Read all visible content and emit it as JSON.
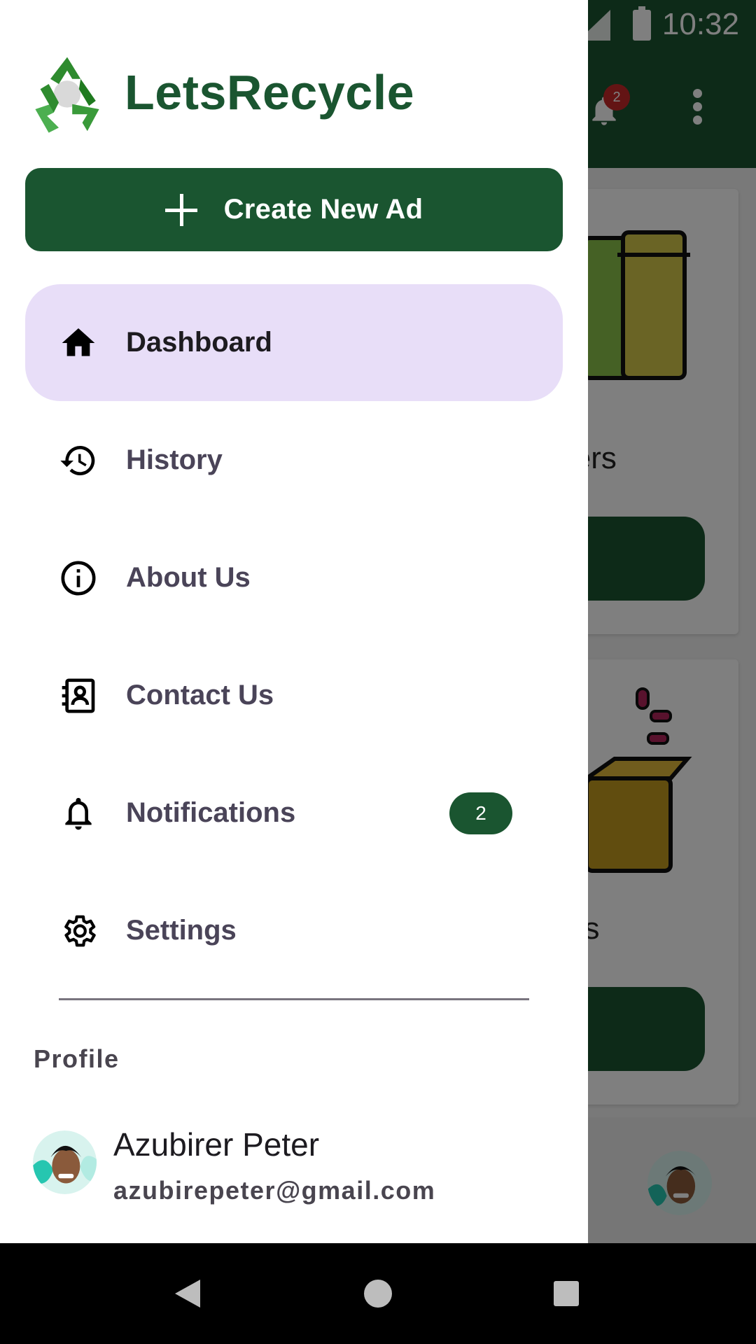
{
  "status_bar": {
    "time": "10:32"
  },
  "toolbar": {
    "notification_badge": "2"
  },
  "background": {
    "card_1_title_fragment": "lers",
    "card_2_title_fragment": "ds"
  },
  "brand": {
    "name": "LetsRecycle",
    "logo_icon": "recycle-logo-icon"
  },
  "drawer": {
    "create_button": {
      "label": "Create New Ad",
      "icon": "plus-icon"
    },
    "nav_items": [
      {
        "label": "Dashboard",
        "icon": "home-icon",
        "active": true
      },
      {
        "label": "History",
        "icon": "history-icon",
        "active": false
      },
      {
        "label": "About Us",
        "icon": "info-icon",
        "active": false
      },
      {
        "label": "Contact Us",
        "icon": "contact-card-icon",
        "active": false
      },
      {
        "label": "Notifications",
        "icon": "bell-icon",
        "active": false,
        "badge": "2"
      },
      {
        "label": "Settings",
        "icon": "gear-icon",
        "active": false
      }
    ],
    "profile": {
      "heading": "Profile",
      "name": "Azubirer Peter",
      "email": "azubirepeter@gmail.com"
    }
  },
  "colors": {
    "brand_green": "#1a5530",
    "active_item_bg": "#e8def8",
    "badge_red": "#c62828"
  }
}
